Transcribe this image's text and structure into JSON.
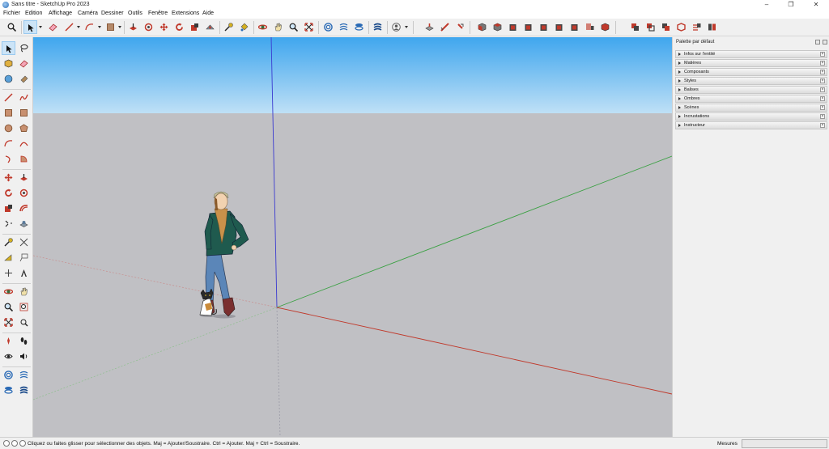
{
  "window": {
    "title": "Sans titre - SketchUp Pro 2023",
    "app_icon": "sketchup-logo-icon",
    "controls": [
      "minimize-icon",
      "restore-icon",
      "close-icon"
    ]
  },
  "menu": [
    "Fichier",
    "Edition",
    "Affichage",
    "Caméra",
    "Dessiner",
    "Outils",
    "Fenêtre",
    "Extensions",
    "Aide"
  ],
  "toolbar": {
    "selected_tool": "select-tool",
    "icons": [
      "search-icon",
      "select-arrow-icon",
      "eraser-icon",
      "pencil-line-icon",
      "shapes-icon",
      "paint-bucket-icon",
      "push-pull-icon",
      "follow-me-icon",
      "move-icon",
      "rotate-icon",
      "scale-icon",
      "offset-icon",
      "tape-measure-icon",
      "paint-icon",
      "orbit-icon",
      "pan-icon",
      "zoom-icon",
      "zoom-extents-icon",
      "warehouse-icon",
      "extension-warehouse-icon",
      "layout-icon",
      "styles-icon",
      "user-icon",
      "solid-tools-icons",
      "sandbox-icons"
    ]
  },
  "viewport": {
    "sky_color": "#5bb3f0",
    "ground_color": "#c0c0c4",
    "axis_colors": {
      "red": "#c0392b",
      "green": "#3aa043",
      "blue": "#3a3ad0"
    }
  },
  "tray": {
    "title": "Palette par défaut",
    "panels": [
      "Infos sur l'entité",
      "Matières",
      "Composants",
      "Styles",
      "Balises",
      "Ombres",
      "Scènes",
      "Incrustations",
      "Instructeur"
    ]
  },
  "status": {
    "message": "Cliquez ou faites glisser pour sélectionner des objets. Maj = Ajouter/Soustraire. Ctrl = Ajouter. Maj + Ctrl = Soustraire.",
    "measure_label": "Mesures",
    "measure_value": ""
  }
}
